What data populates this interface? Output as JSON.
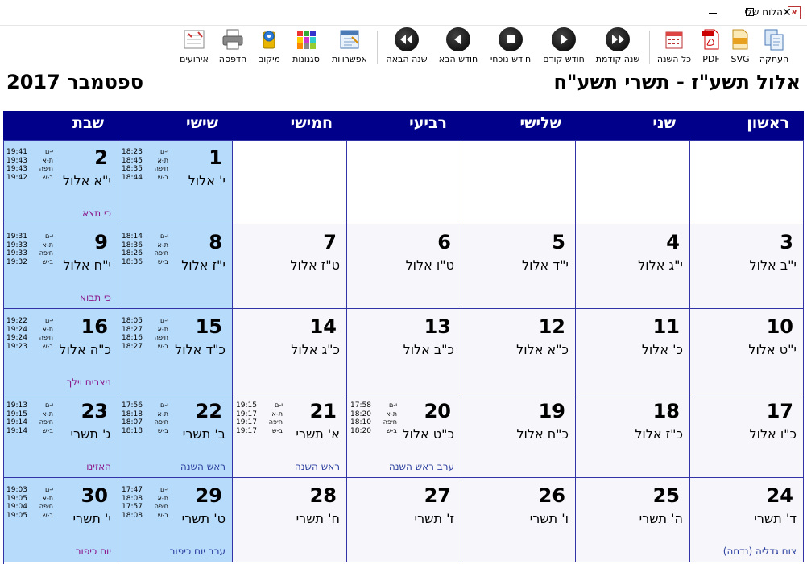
{
  "window": {
    "title": "הלוח שלי",
    "app_icon_glyph": "א",
    "minimize": "—",
    "close": "✕"
  },
  "toolbar": {
    "events": "אירועים",
    "print": "הדפסה",
    "location": "מיקום",
    "styles": "סגנונות",
    "options": "אפשרויות",
    "next_year": "שנה הבאה",
    "next_month": "חודש הבא",
    "current_month": "חודש נוכחי",
    "prev_month": "חודש קודם",
    "prev_year": "שנה קודמת",
    "whole_year": "כל השנה",
    "pdf": "PDF",
    "svg": "SVG",
    "copy": "העתקה"
  },
  "header": {
    "hebrew_months": "אלול תשע\"ז - תשרי תשע\"ח",
    "gregorian_month": "ספטמבר 2017"
  },
  "weekdays": [
    "ראשון",
    "שני",
    "שלישי",
    "רביעי",
    "חמישי",
    "שישי",
    "שבת"
  ],
  "time_labels": [
    "י-ם",
    "ת-א",
    "חיפה",
    "ב-ש"
  ],
  "weeks": [
    [
      null,
      null,
      null,
      null,
      null,
      {
        "day": "1",
        "heb": "י' אלול",
        "times": [
          "18:23",
          "18:45",
          "18:35",
          "18:44"
        ],
        "note": ""
      },
      {
        "day": "2",
        "heb": "י\"א אלול",
        "times": [
          "19:41",
          "19:43",
          "19:43",
          "19:42"
        ],
        "note": "כי תצא"
      }
    ],
    [
      {
        "day": "3",
        "heb": "י\"ב אלול",
        "note": ""
      },
      {
        "day": "4",
        "heb": "י\"ג אלול",
        "note": ""
      },
      {
        "day": "5",
        "heb": "י\"ד אלול",
        "note": ""
      },
      {
        "day": "6",
        "heb": "ט\"ו אלול",
        "note": ""
      },
      {
        "day": "7",
        "heb": "ט\"ז אלול",
        "note": ""
      },
      {
        "day": "8",
        "heb": "י\"ז אלול",
        "times": [
          "18:14",
          "18:36",
          "18:26",
          "18:36"
        ],
        "note": ""
      },
      {
        "day": "9",
        "heb": "י\"ח אלול",
        "times": [
          "19:31",
          "19:33",
          "19:33",
          "19:32"
        ],
        "note": "כי תבוא"
      }
    ],
    [
      {
        "day": "10",
        "heb": "י\"ט אלול",
        "note": ""
      },
      {
        "day": "11",
        "heb": "כ' אלול",
        "note": ""
      },
      {
        "day": "12",
        "heb": "כ\"א אלול",
        "note": ""
      },
      {
        "day": "13",
        "heb": "כ\"ב אלול",
        "note": ""
      },
      {
        "day": "14",
        "heb": "כ\"ג אלול",
        "note": ""
      },
      {
        "day": "15",
        "heb": "כ\"ד אלול",
        "times": [
          "18:05",
          "18:27",
          "18:16",
          "18:27"
        ],
        "note": ""
      },
      {
        "day": "16",
        "heb": "כ\"ה אלול",
        "times": [
          "19:22",
          "19:24",
          "19:24",
          "19:23"
        ],
        "note": "ניצבים וילך"
      }
    ],
    [
      {
        "day": "17",
        "heb": "כ\"ו אלול",
        "note": ""
      },
      {
        "day": "18",
        "heb": "כ\"ז אלול",
        "note": ""
      },
      {
        "day": "19",
        "heb": "כ\"ח אלול",
        "note": ""
      },
      {
        "day": "20",
        "heb": "כ\"ט אלול",
        "times": [
          "17:58",
          "18:20",
          "18:10",
          "18:20"
        ],
        "note": "ערב ראש השנה"
      },
      {
        "day": "21",
        "heb": "א' תשרי",
        "times": [
          "19:15",
          "19:17",
          "19:17",
          "19:17"
        ],
        "note": "ראש השנה"
      },
      {
        "day": "22",
        "heb": "ב' תשרי",
        "times": [
          "17:56",
          "18:18",
          "18:07",
          "18:18"
        ],
        "note": "ראש השנה"
      },
      {
        "day": "23",
        "heb": "ג' תשרי",
        "times": [
          "19:13",
          "19:15",
          "19:14",
          "19:14"
        ],
        "note": "האזינו"
      }
    ],
    [
      {
        "day": "24",
        "heb": "ד' תשרי",
        "note": "צום גדליה (נדחה)"
      },
      {
        "day": "25",
        "heb": "ה' תשרי",
        "note": ""
      },
      {
        "day": "26",
        "heb": "ו' תשרי",
        "note": ""
      },
      {
        "day": "27",
        "heb": "ז' תשרי",
        "note": ""
      },
      {
        "day": "28",
        "heb": "ח' תשרי",
        "note": ""
      },
      {
        "day": "29",
        "heb": "ט' תשרי",
        "times": [
          "17:47",
          "18:08",
          "17:57",
          "18:08"
        ],
        "note": "ערב יום כיפור"
      },
      {
        "day": "30",
        "heb": "י' תשרי",
        "times": [
          "19:03",
          "19:05",
          "19:04",
          "19:05"
        ],
        "note": "יום כיפור"
      }
    ]
  ],
  "colors": {
    "header_bar": "#00008b",
    "shabbat_bg": "#b7dbfb",
    "weekday_bg": "#f7f7fb",
    "grid_line": "#3333a8",
    "parasha": "#8b1a8b",
    "holiday": "#2c3e9e"
  }
}
